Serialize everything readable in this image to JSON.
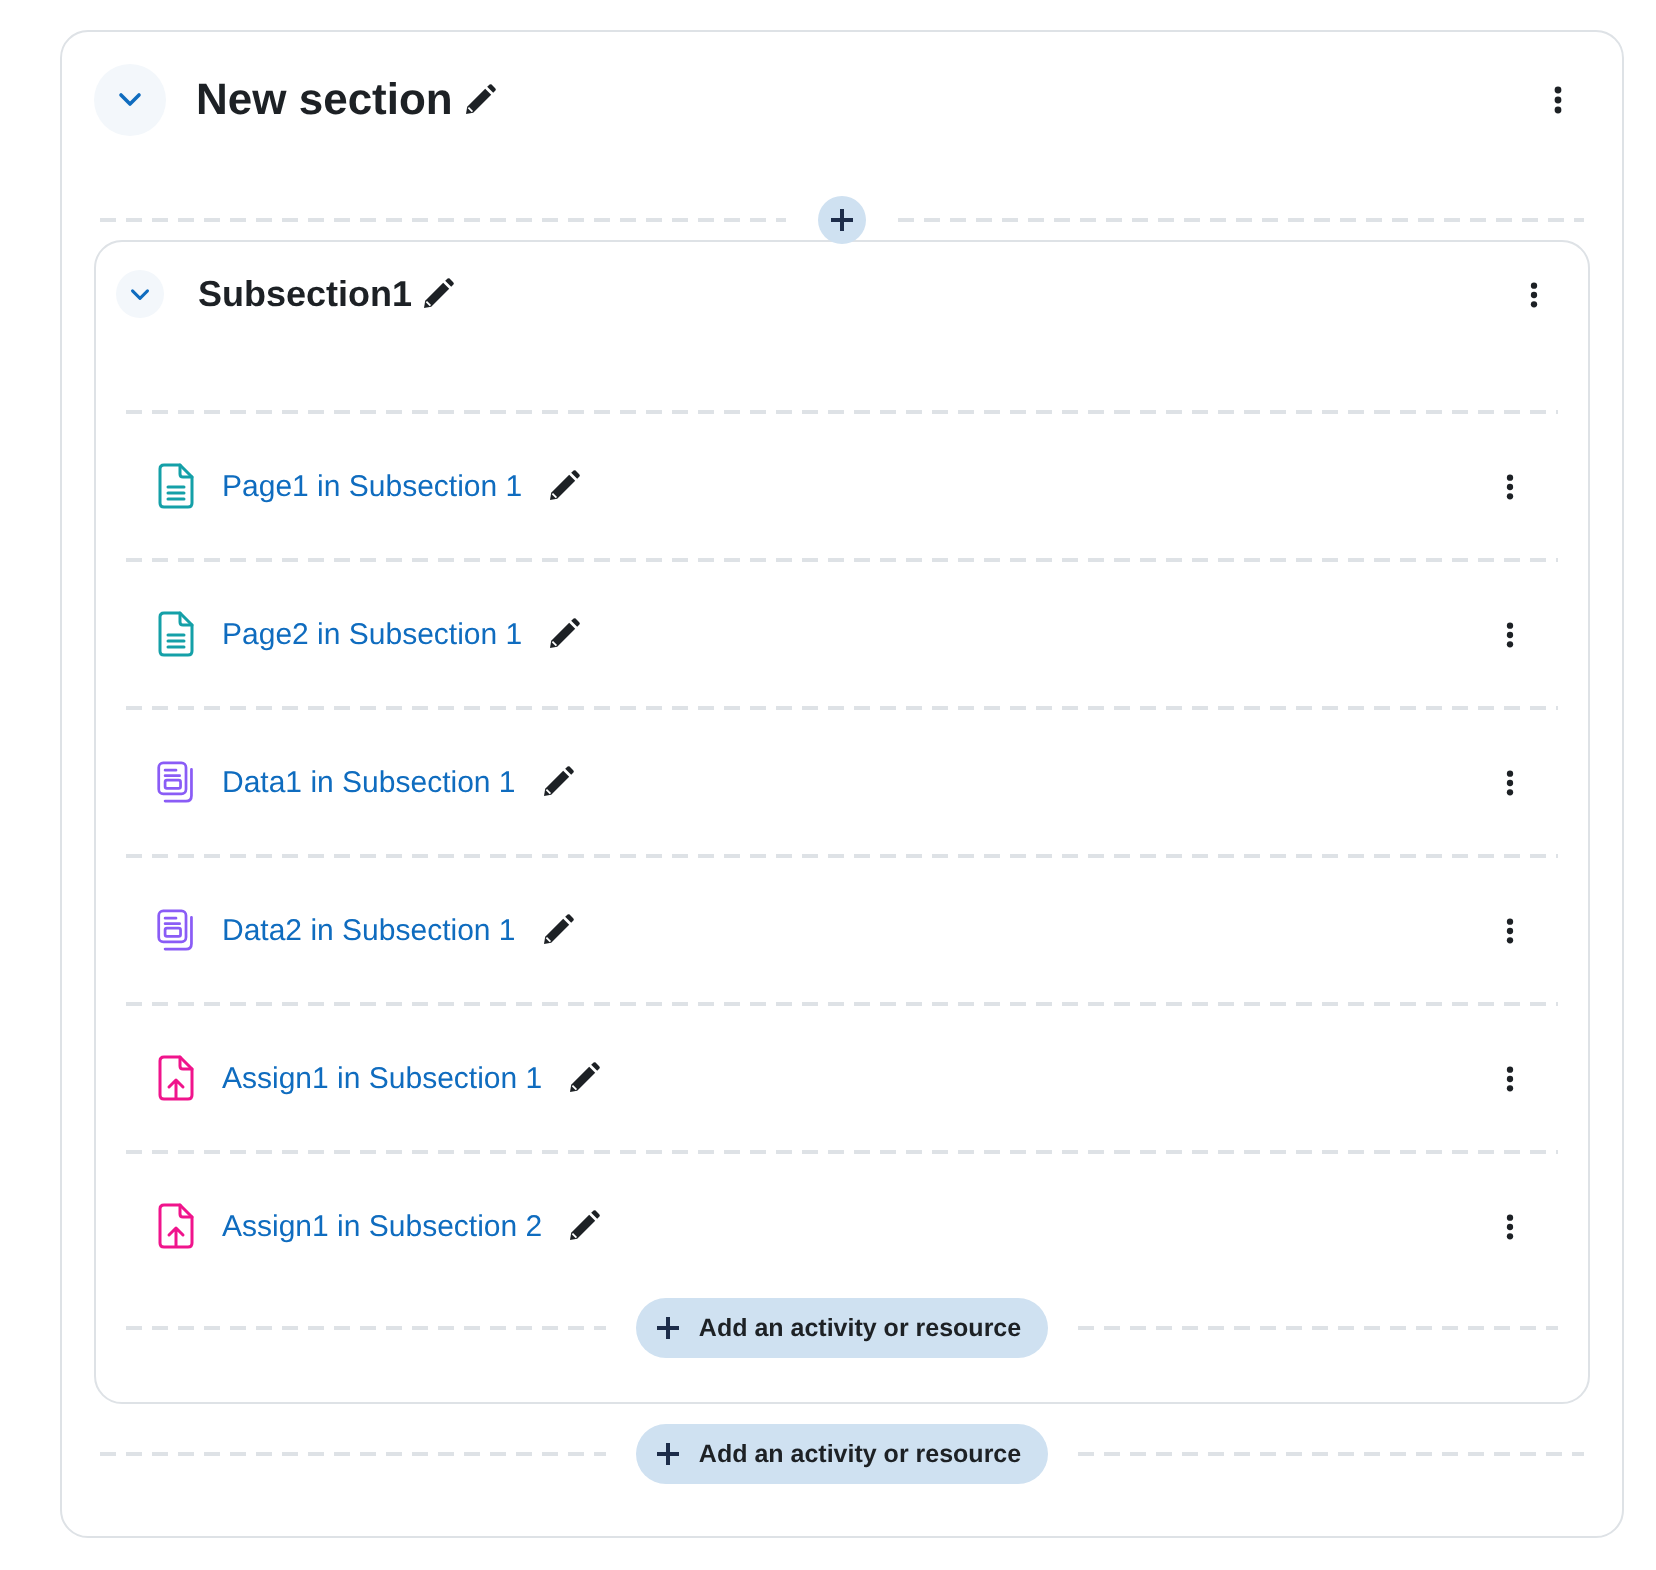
{
  "section": {
    "title": "New section",
    "expanded": true
  },
  "subsection": {
    "title": "Subsection1",
    "expanded": true,
    "activities": [
      {
        "name": "Page1 in Subsection 1",
        "kind": "page"
      },
      {
        "name": "Page2 in Subsection 1",
        "kind": "page"
      },
      {
        "name": "Data1 in Subsection 1",
        "kind": "data"
      },
      {
        "name": "Data2 in Subsection 1",
        "kind": "data"
      },
      {
        "name": "Assign1 in Subsection 1",
        "kind": "assign"
      },
      {
        "name": "Assign1 in Subsection 2",
        "kind": "assign"
      }
    ],
    "add_button": {
      "label": "Add an activity or resource"
    }
  },
  "add_button": {
    "label": "Add an activity or resource"
  }
}
